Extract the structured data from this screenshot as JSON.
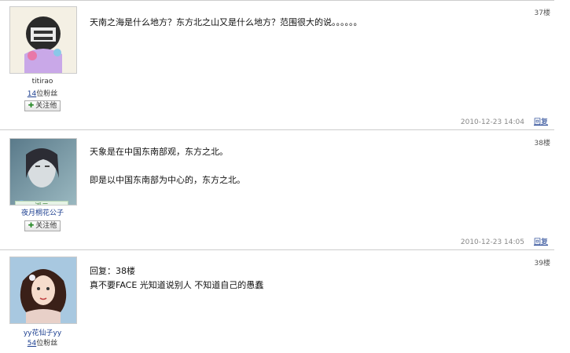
{
  "posts": [
    {
      "floor": "37楼",
      "username": "titirao",
      "fans_count": "14",
      "fans_label": "位粉丝",
      "follow_label": "关注他",
      "lines": [
        "天南之海是什么地方？东方北之山又是什么地方？范围很大的说。。。。。。"
      ],
      "timestamp": "2010-12-23 14:04",
      "reply_label": "回复"
    },
    {
      "floor": "38楼",
      "username": "夜月桐花公子",
      "tag": "浮云",
      "follow_label": "关注他",
      "lines": [
        "天象是在中国东南部观，东方之北。",
        "即是以中国东南部为中心的，东方之北。"
      ],
      "timestamp": "2010-12-23 14:05",
      "reply_label": "回复"
    },
    {
      "floor": "39楼",
      "username": "yy花仙子yy",
      "fans_count": "54",
      "fans_label": "位粉丝",
      "lines": [
        "回复：38楼",
        "真不要FACE 光知道说别人 不知道自己的愚蠢"
      ]
    }
  ]
}
